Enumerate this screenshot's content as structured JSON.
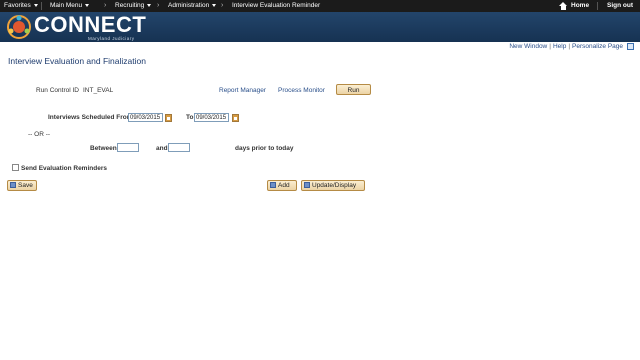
{
  "topnav": {
    "favorites": "Favorites",
    "main_menu": "Main Menu",
    "recruiting": "Recruiting",
    "administration": "Administration",
    "breadcrumb_current": "Interview Evaluation Reminder",
    "home": "Home",
    "sign_out": "Sign out"
  },
  "brand": {
    "name": "CONNECT",
    "subtitle": "Maryland Judiciary"
  },
  "links": {
    "new_window": "New Window",
    "help": "Help",
    "personalize": "Personalize Page"
  },
  "page": {
    "title": "Interview Evaluation and Finalization"
  },
  "run_control": {
    "label": "Run Control ID",
    "value": "INT_EVAL",
    "report_manager": "Report Manager",
    "process_monitor": "Process Monitor",
    "run_button": "Run"
  },
  "interviews": {
    "label": "Interviews Scheduled From",
    "from_value": "09/03/2015",
    "to_label": "To",
    "to_value": "09/03/2015"
  },
  "or_label": "-- OR --",
  "between": {
    "label": "Between",
    "value1": "",
    "and_label": "and",
    "value2": "",
    "suffix": "days prior to today"
  },
  "reminders": {
    "label": "Send Evaluation Reminders",
    "checked": false
  },
  "toolbar": {
    "save": "Save",
    "add": "Add",
    "update_display": "Update/Display"
  }
}
